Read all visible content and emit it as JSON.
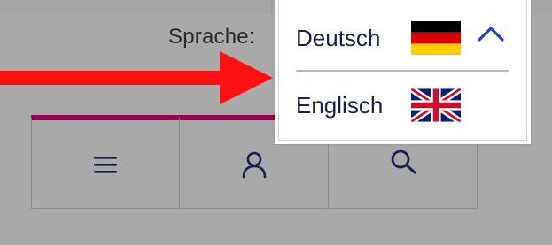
{
  "language_label": "Sprache:",
  "language_menu": {
    "options": [
      {
        "label": "Deutsch",
        "flag": "germany-flag-icon",
        "selected": true
      },
      {
        "label": "Englisch",
        "flag": "uk-flag-icon",
        "selected": false
      }
    ],
    "toggle_icon": "chevron-up-icon"
  },
  "toolbar": {
    "buttons": [
      {
        "icon": "menu-icon"
      },
      {
        "icon": "user-icon"
      },
      {
        "icon": "search-icon"
      }
    ]
  },
  "colors": {
    "accent": "#990050",
    "text_navy": "#1a1f4d",
    "arrow": "#ff1010",
    "background": "#a9a9a9"
  }
}
